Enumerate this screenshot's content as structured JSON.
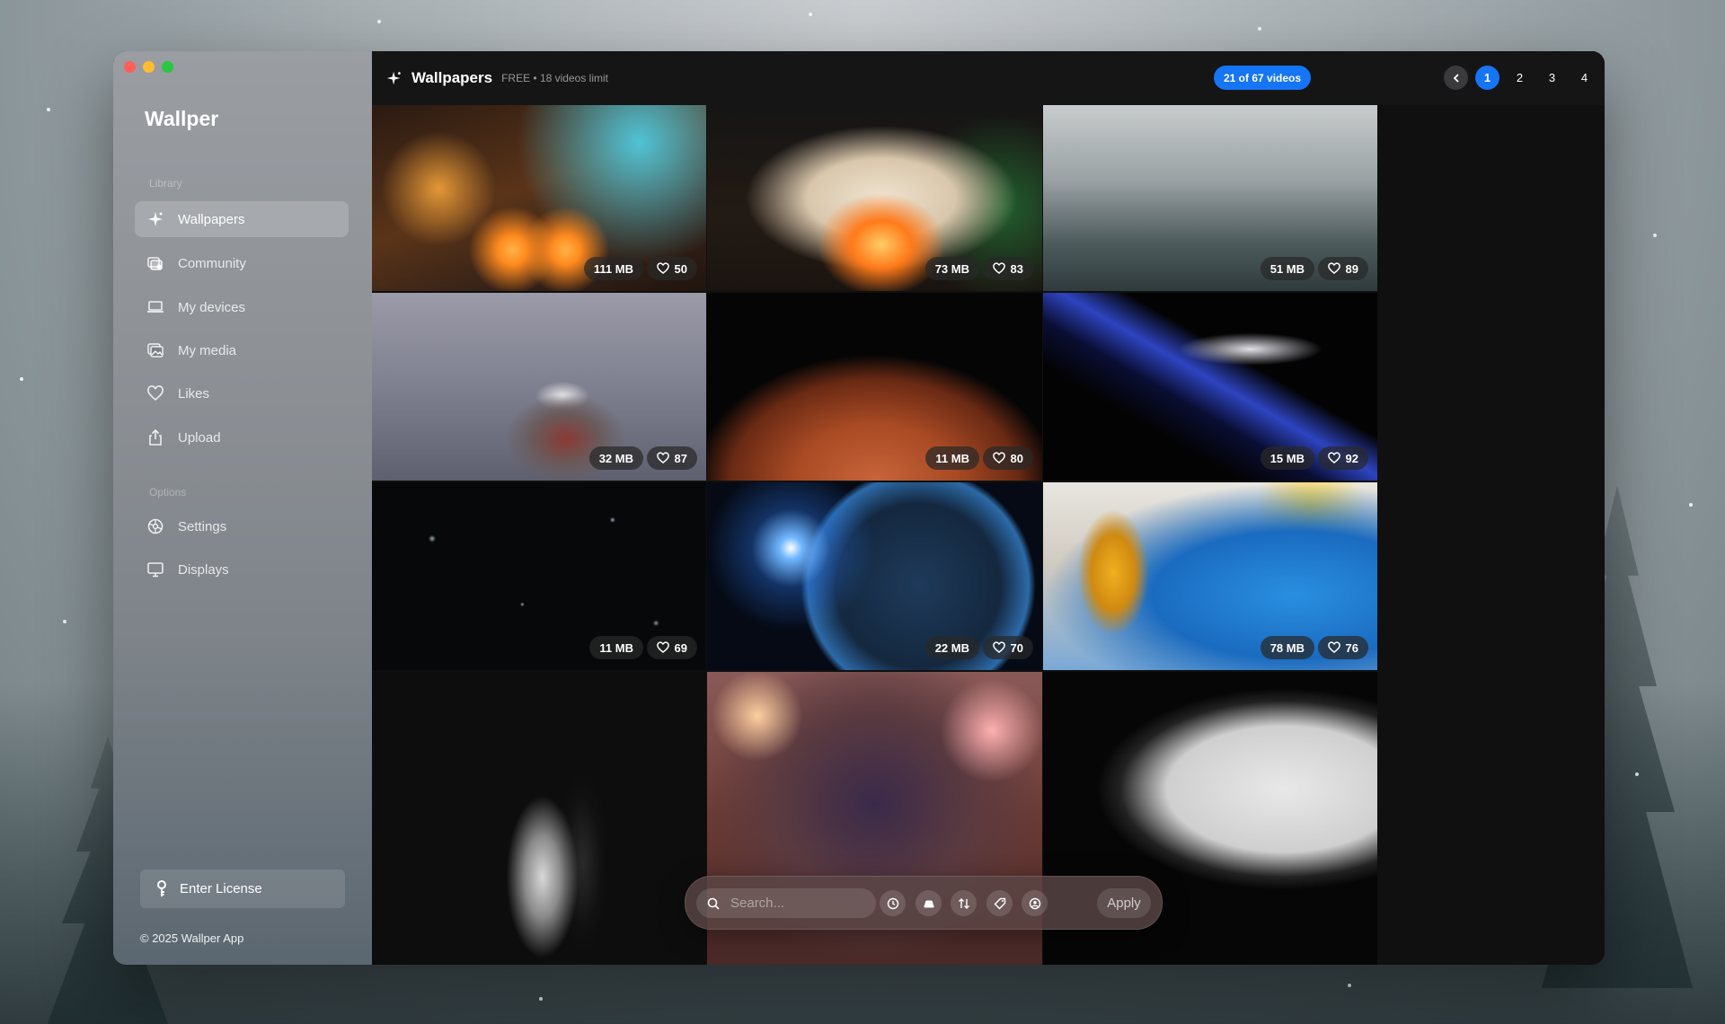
{
  "colors": {
    "accent": "#1575f5",
    "sidebar_top": "#9a9da2",
    "sidebar_bottom": "#5b6770",
    "main_bg": "#101011"
  },
  "sidebar": {
    "app_title": "Wallper",
    "library_label": "Library",
    "options_label": "Options",
    "items": [
      {
        "label": "Wallpapers",
        "icon": "sparkle-icon",
        "active": true
      },
      {
        "label": "Community",
        "icon": "community-icon"
      },
      {
        "label": "My devices",
        "icon": "laptop-icon"
      },
      {
        "label": "My media",
        "icon": "photos-icon"
      },
      {
        "label": "Likes",
        "icon": "heart-icon"
      },
      {
        "label": "Upload",
        "icon": "upload-icon"
      }
    ],
    "options": [
      {
        "label": "Settings",
        "icon": "gear-icon"
      },
      {
        "label": "Displays",
        "icon": "display-icon"
      }
    ],
    "license_label": "Enter License",
    "copyright": "© 2025 Wallper App"
  },
  "header": {
    "title": "Wallpapers",
    "plan": "FREE • 18 videos limit",
    "count": "21 of 67 videos",
    "pages": [
      "1",
      "2",
      "3",
      "4"
    ],
    "current_page": "1"
  },
  "tiles": [
    {
      "size": "111 MB",
      "likes": "50",
      "scene": "candles"
    },
    {
      "size": "73 MB",
      "likes": "83",
      "scene": "fireplace"
    },
    {
      "size": "51 MB",
      "likes": "89",
      "scene": "foggy-forest"
    },
    {
      "size": "32 MB",
      "likes": "87",
      "scene": "seagull"
    },
    {
      "size": "11 MB",
      "likes": "80",
      "scene": "mars"
    },
    {
      "size": "15 MB",
      "likes": "92",
      "scene": "space-shuttle"
    },
    {
      "size": "11 MB",
      "likes": "69",
      "scene": "starfield"
    },
    {
      "size": "22 MB",
      "likes": "70",
      "scene": "earth"
    },
    {
      "size": "78 MB",
      "likes": "76",
      "scene": "beer-pool"
    },
    {
      "scene": "chess"
    },
    {
      "scene": "castle-fireworks"
    },
    {
      "scene": "vinyl"
    }
  ],
  "search": {
    "placeholder": "Search...",
    "apply_label": "Apply"
  },
  "filters": [
    "clock-icon",
    "car-icon",
    "sort-icon",
    "tag-icon",
    "user-icon"
  ]
}
